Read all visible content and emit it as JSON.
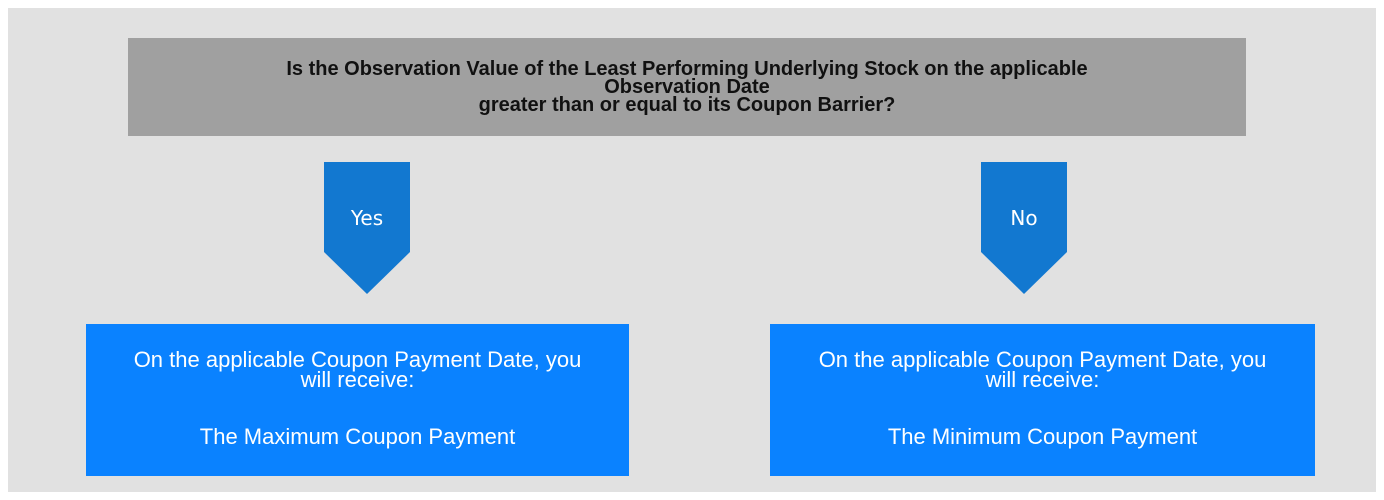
{
  "question": {
    "line1": "Is the Observation Value of the Least Performing Underlying Stock on the applicable",
    "line2": "Observation Date",
    "line3": "greater than or equal to its Coupon Barrier?"
  },
  "branches": [
    {
      "label": "Yes",
      "result_line1": "On the applicable Coupon Payment Date, you",
      "result_line2": "will receive:",
      "outcome": "The Maximum Coupon Payment"
    },
    {
      "label": "No",
      "result_line1": "On the applicable Coupon Payment Date, you",
      "result_line2": "will receive:",
      "outcome": "The Minimum Coupon Payment"
    }
  ],
  "colors": {
    "background": "#e1e1e1",
    "question_box": "#a0a0a0",
    "arrow": "#1278d0",
    "result_box": "#0a82ff",
    "result_text": "#ffffff"
  }
}
